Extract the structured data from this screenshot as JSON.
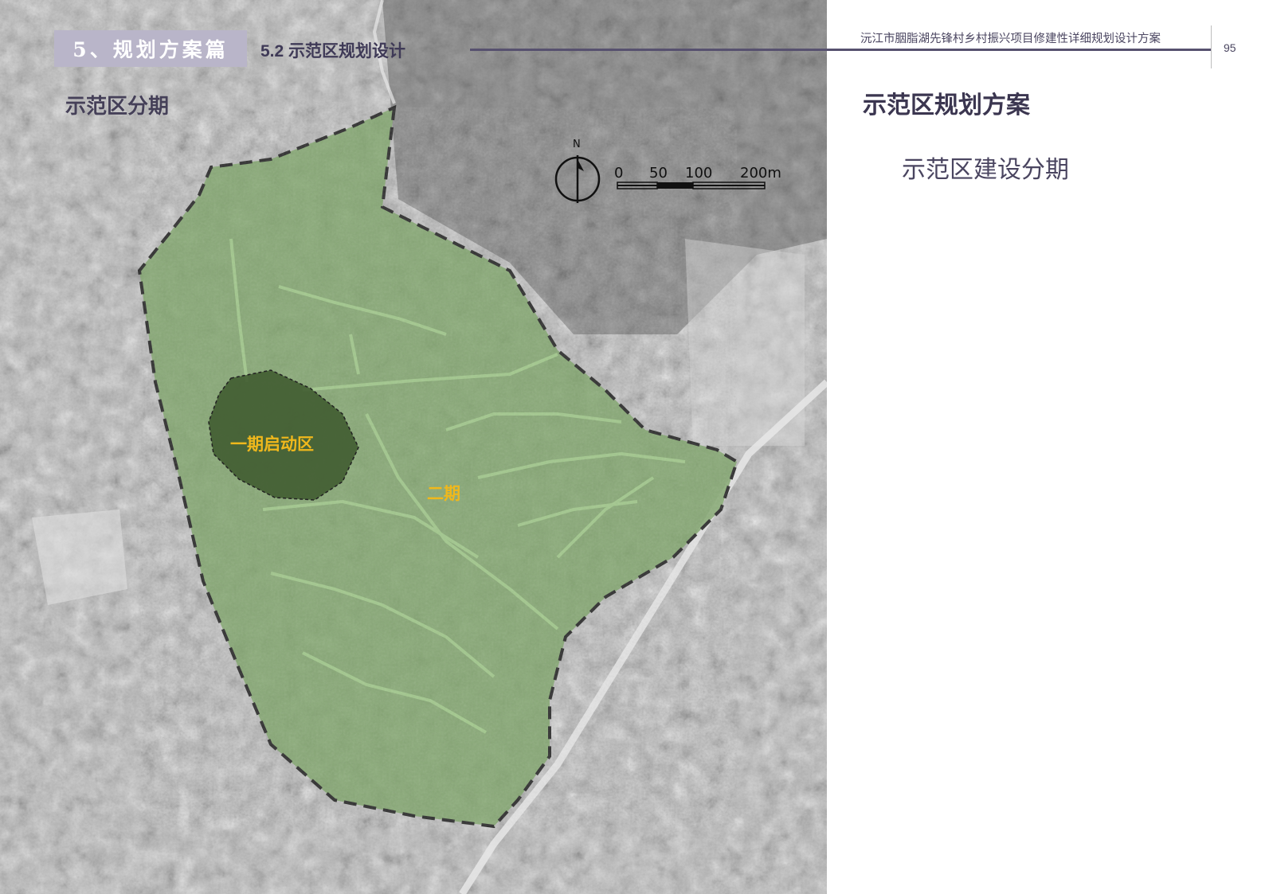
{
  "header": {
    "section_tag": "5、规划方案篇",
    "section_sub": "5.2 示范区规划设计",
    "doc_title": "沅江市胭脂湖先锋村乡村振兴项目修建性详细规划设计方案",
    "page_number": "95"
  },
  "map": {
    "title": "示范区分期",
    "phase1_label": "一期启动区",
    "phase2_label": "二期",
    "north_label": "N",
    "scale_labels": [
      "0",
      "50",
      "100",
      "200m"
    ],
    "colors": {
      "phase2_fill": "#7fa56a",
      "phase1_fill": "#3f5a2f",
      "phase_label": "#f0b81c",
      "boundary_dash": "#333333"
    }
  },
  "panel": {
    "title": "示范区规划方案",
    "subtitle": "示范区建设分期"
  },
  "colors": {
    "section_tag_bg": "#b9b5c9",
    "accent_dark": "#3f3a57"
  }
}
